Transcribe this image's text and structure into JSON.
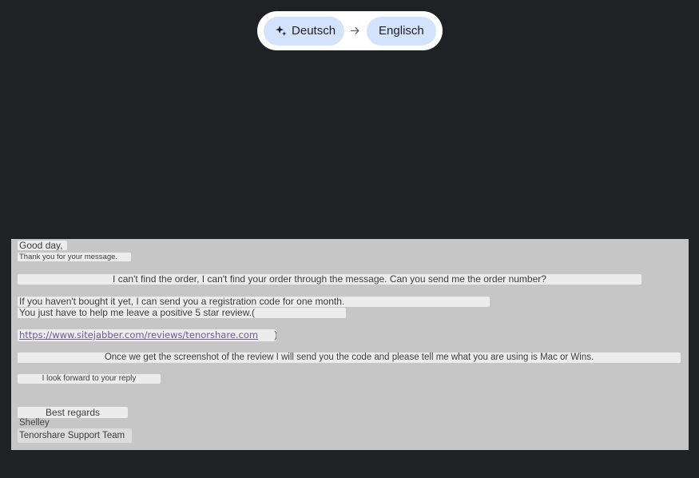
{
  "translation_bar": {
    "source_language": "Deutsch",
    "target_language": "Englisch",
    "source_icon": "sparkle-icon",
    "arrow_icon": "arrow-right-icon"
  },
  "email": {
    "greeting": "Good day,",
    "thanks": "Thank you for your message.",
    "order_line": "I can't find the order, I can't find your order through the message. Can you send me the order number?",
    "registration_line": "If you haven't bought it yet, I can send you a registration code for one month.",
    "review_line": "You just have to help me leave a positive 5 star review.(",
    "review_link": "https://www.sitejabber.com/reviews/tenorshare.com",
    "review_close": ")",
    "screenshot_line": "Once we get the screenshot of the review I will send you the code and please tell me what you are using is Mac or Wins.",
    "reply_line": "I look forward to your reply",
    "closing": "Best regards",
    "signature_name": "Shelley",
    "signature_team": "Tenorshare Support Team"
  },
  "colors": {
    "background": "#202124",
    "chip": "#d3e3fd",
    "document": "#c6c6c6"
  }
}
